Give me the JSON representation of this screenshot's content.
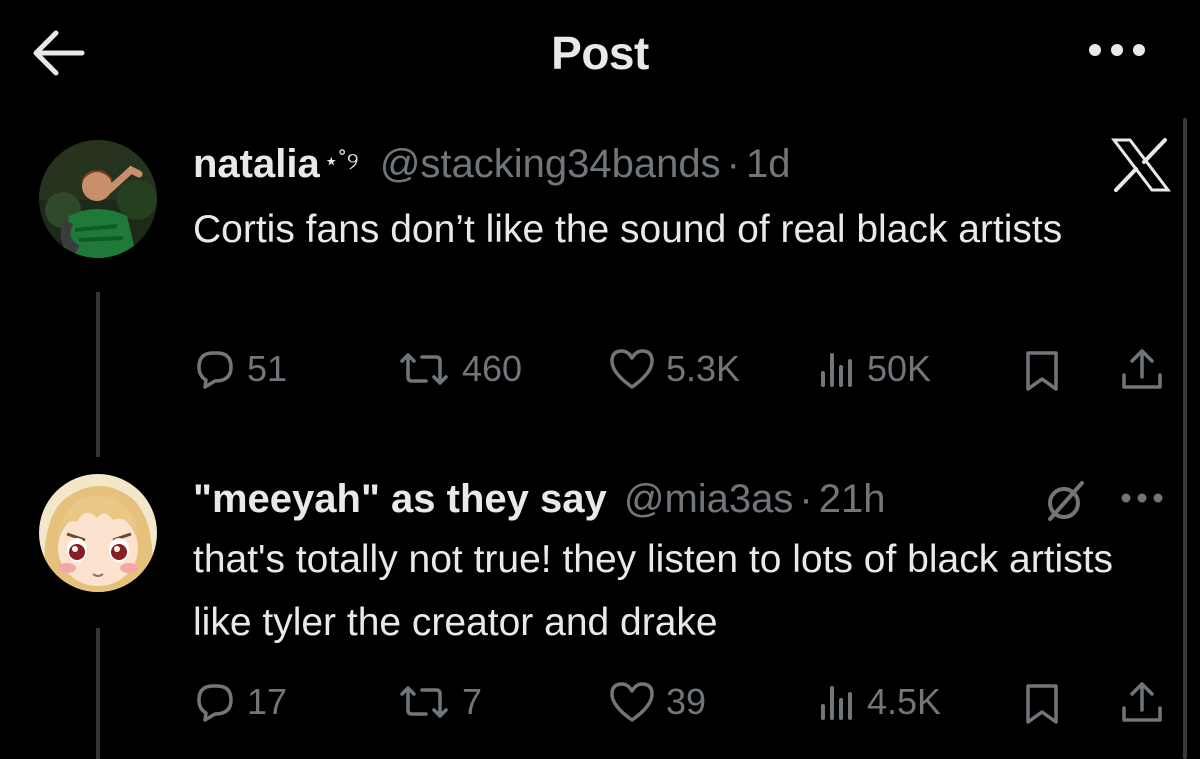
{
  "header": {
    "title": "Post"
  },
  "posts": [
    {
      "display_name": "natalia",
      "name_decoration": "⋆˚୨",
      "handle": "@stacking34bands",
      "time": "1d",
      "text": "Cortis fans don’t like the sound of real black artists",
      "actions": {
        "replies": "51",
        "reposts": "460",
        "likes": "5.3K",
        "views": "50K"
      }
    },
    {
      "display_name": "\"meeyah\" as they say",
      "handle": "@mia3as",
      "time": "21h",
      "text": "that's totally not true! they listen to lots of black artists like tyler the creator and drake",
      "actions": {
        "replies": "17",
        "reposts": "7",
        "likes": "39",
        "views": "4.5K"
      }
    }
  ],
  "separator": "·",
  "icons": [
    "back-arrow-icon",
    "more-icon",
    "x-logo-icon",
    "reply-icon",
    "repost-icon",
    "like-icon",
    "views-icon",
    "bookmark-icon",
    "share-icon",
    "grok-icon"
  ]
}
